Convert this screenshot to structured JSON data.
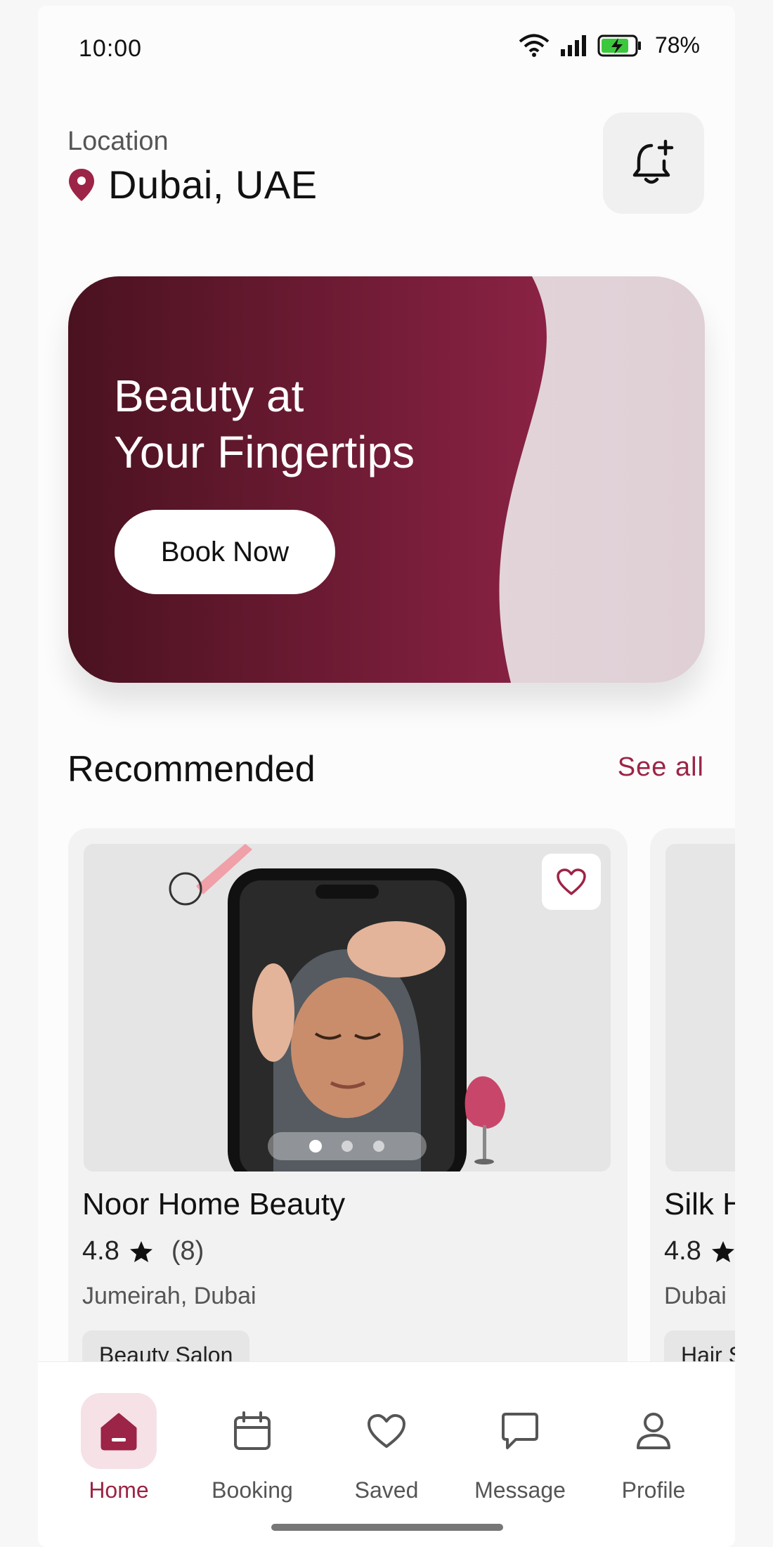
{
  "status_bar": {
    "time": "10:00",
    "battery": "78%"
  },
  "header": {
    "location_label": "Location",
    "location_value": "Dubai,  UAE"
  },
  "hero": {
    "title_line1": "Beauty at",
    "title_line2": "Your Fingertips",
    "button_label": "Book Now"
  },
  "recommended": {
    "title": "Recommended",
    "see_all": "See all",
    "cards": [
      {
        "name": "Noor Home Beauty",
        "rating": "4.8",
        "reviews": "(8)",
        "location": "Jumeirah,  Dubai",
        "tag": "Beauty Salon"
      },
      {
        "name": "Silk H",
        "rating": "4.8",
        "location": "Dubai",
        "tag": "Hair S"
      }
    ]
  },
  "nav": [
    {
      "label": "Home",
      "icon": "home-icon",
      "active": true
    },
    {
      "label": "Booking",
      "icon": "calendar-icon"
    },
    {
      "label": "Saved",
      "icon": "heart-icon"
    },
    {
      "label": "Message",
      "icon": "chat-icon"
    },
    {
      "label": "Profile",
      "icon": "user-icon"
    }
  ],
  "colors": {
    "accent": "#9c2446",
    "hero_dark": "#4a1220",
    "hero_mid": "#8a2244"
  }
}
